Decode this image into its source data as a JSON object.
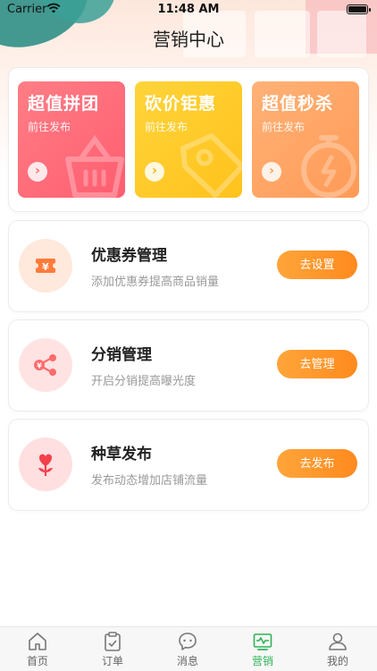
{
  "status": {
    "carrier": "Carrier",
    "time": "11:48 AM"
  },
  "nav": {
    "title": "营销中心"
  },
  "promos": [
    {
      "title": "超值拼团",
      "subtitle": "前往发布",
      "icon": "basket-icon"
    },
    {
      "title": "砍价钜惠",
      "subtitle": "前往发布",
      "icon": "price-tag-icon"
    },
    {
      "title": "超值秒杀",
      "subtitle": "前往发布",
      "icon": "stopwatch-icon"
    }
  ],
  "features": [
    {
      "title": "优惠券管理",
      "desc": "添加优惠券提高商品销量",
      "button": "去设置",
      "icon": "coupon-icon"
    },
    {
      "title": "分销管理",
      "desc": "开启分销提高曝光度",
      "button": "去管理",
      "icon": "share-icon"
    },
    {
      "title": "种草发布",
      "desc": "发布动态增加店铺流量",
      "button": "去发布",
      "icon": "flower-icon"
    }
  ],
  "tabs": [
    {
      "label": "首页",
      "icon": "home-icon"
    },
    {
      "label": "订单",
      "icon": "order-icon"
    },
    {
      "label": "消息",
      "icon": "message-icon"
    },
    {
      "label": "营销",
      "icon": "marketing-icon",
      "active": true
    },
    {
      "label": "我的",
      "icon": "profile-icon"
    }
  ],
  "colors": {
    "accent": "#ff8a1e",
    "active_tab": "#2fb357"
  }
}
